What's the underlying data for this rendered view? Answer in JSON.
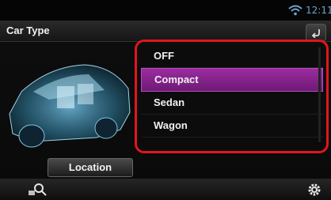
{
  "status_bar": {
    "time": "12:11",
    "wifi_icon": "wifi-icon"
  },
  "header": {
    "title": "Car Type",
    "back_icon": "back-arrow-icon"
  },
  "car_type_list": {
    "items": [
      {
        "label": "OFF",
        "selected": false
      },
      {
        "label": "Compact",
        "selected": true
      },
      {
        "label": "Sedan",
        "selected": false
      },
      {
        "label": "Wagon",
        "selected": false
      }
    ]
  },
  "buttons": {
    "location_label": "Location"
  },
  "bottom_bar": {
    "left_icon": "zoom-search-icon",
    "right_icon": "gear-icon"
  },
  "colors": {
    "highlight_frame": "#e0161c",
    "selected_item": "#8a2590",
    "clock": "#6aa6c8"
  }
}
